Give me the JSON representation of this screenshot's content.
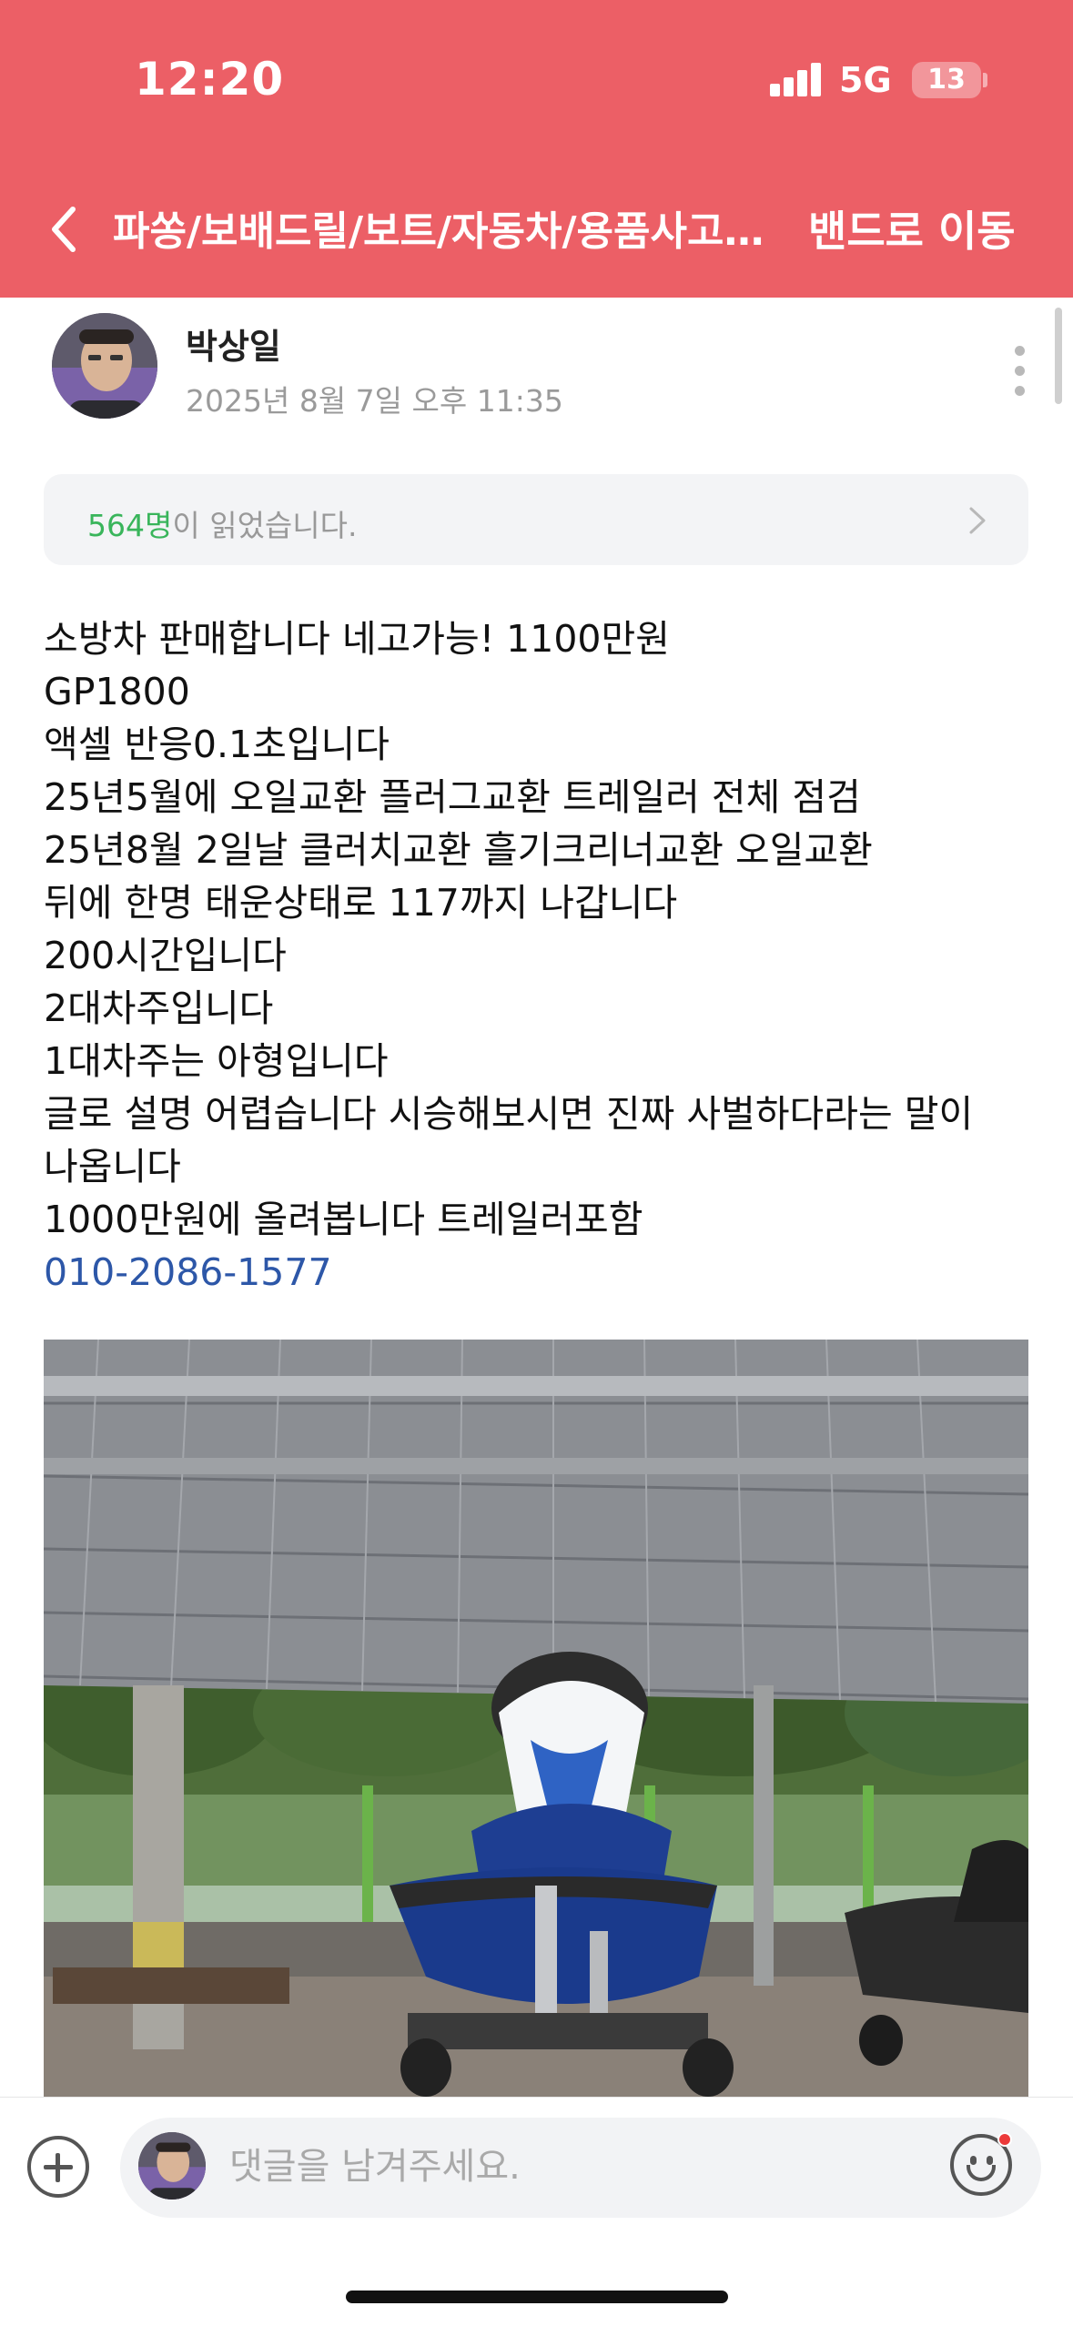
{
  "status_bar": {
    "time": "12:20",
    "network": "5G",
    "battery": "13"
  },
  "header": {
    "back_icon": "chevron-left-icon",
    "title": "파쏭/보배드릴/보트/자동차/용품사고…",
    "band_button": "밴드로 이동",
    "background_color": "#ec5f66"
  },
  "post": {
    "author": "박상일",
    "date": "2025년 8월 7일 오후 11:35",
    "more_icon": "more-vertical-icon",
    "read_count": "564명",
    "read_suffix": "이 읽었습니다.",
    "read_count_color": "#39b55b",
    "lines": [
      "소방차 판매합니다 네고가능! 1100만원",
      "GP1800",
      "액셀 반응0.1초입니다",
      "25년5월에 오일교환 플러그교환 트레일러 전체 점검",
      "25년8월 2일날 클러치교환 흘기크리너교환 오일교환",
      "뒤에 한명 태운상태로 117까지 나갑니다",
      "200시간입니다",
      "2대차주입니다",
      "1대차주는 아형입니다",
      "글로 설명 어렵습니다 시승해보시면 진짜 사벌하다라는 말이",
      "나옵니다",
      "1000만원에 올려봅니다 트레일러포함"
    ],
    "phone": "010-2086-1577",
    "phone_color": "#2d57a8",
    "photo_description_icon": "jet-ski-photo"
  },
  "comment_bar": {
    "add_icon": "plus-circle-icon",
    "placeholder": "댓글을 남겨주세요.",
    "emoji_icon": "emoji-icon"
  }
}
